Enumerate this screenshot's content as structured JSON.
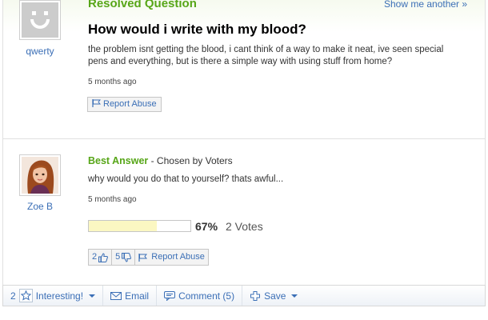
{
  "question": {
    "status_title": "Resolved Question",
    "show_another": "Show me another »",
    "title": "How would i write with my blood?",
    "body": "the problem isnt getting the blood, i cant think of a way to make it neat, ive seen special pens and everything, but is there a simple way with using stuff from home?",
    "asker": "qwerty",
    "timestamp": "5 months ago",
    "report_abuse": "Report Abuse"
  },
  "best_answer": {
    "label": "Best Answer",
    "chosen_by": " - Chosen by Voters",
    "author": "Zoe B",
    "body": "why would you do that to yourself? thats awful...",
    "timestamp": "5 months ago",
    "vote_fraction": 0.67,
    "vote_percent": "67%",
    "vote_count": "2 Votes",
    "thumbs_up_count": "2",
    "thumbs_down_count": "5",
    "report_abuse": "Report Abuse"
  },
  "footer": {
    "interesting_count": "2",
    "interesting_label": "Interesting!",
    "email_label": "Email",
    "comment_label": "Comment (5)",
    "save_label": "Save"
  },
  "icons": {
    "asker_avatar": "default-smiley-avatar",
    "answerer_avatar": "girl-portrait-avatar",
    "report": "flag-icon",
    "thumbs_up": "thumbs-up-icon",
    "thumbs_down": "thumbs-down-icon",
    "interesting": "star-icon",
    "email": "envelope-icon",
    "comment": "speech-bubble-icon",
    "save": "plus-icon"
  },
  "colors": {
    "accent_green": "#57a618",
    "link_blue": "#3b6fb6",
    "vote_fill": "#fbf7c2"
  }
}
